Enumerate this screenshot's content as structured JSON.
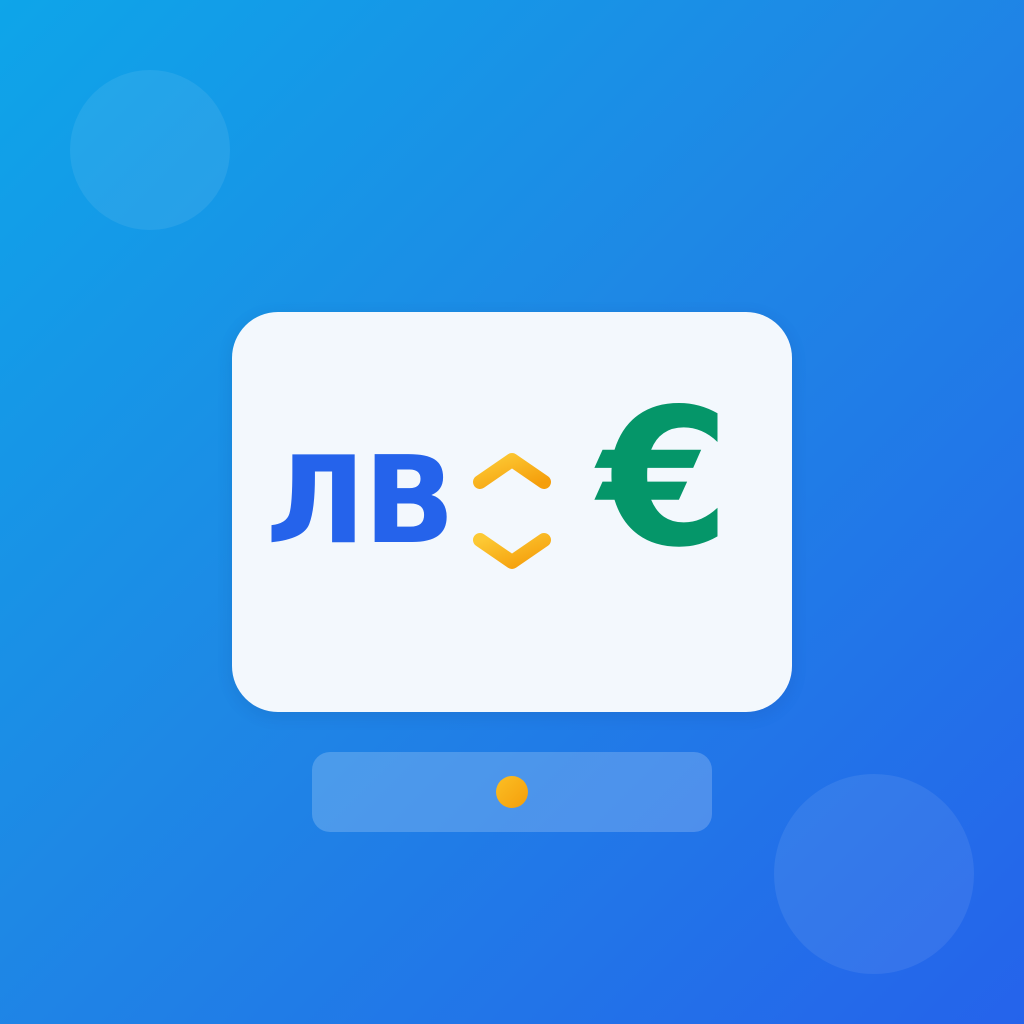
{
  "colors": {
    "background_start": "#0ea5e9",
    "background_end": "#2563eb",
    "card": "#f3f8fd",
    "lev": "#2563eb",
    "euro": "#059669",
    "swap_arrows": "#f5b021",
    "pill_dot": "#f5a70f"
  },
  "icon": {
    "lev_label": "ЛВ",
    "euro_label": "€",
    "swap_icon": "up-down-chevrons-icon",
    "indicator_icon": "dot-icon"
  }
}
